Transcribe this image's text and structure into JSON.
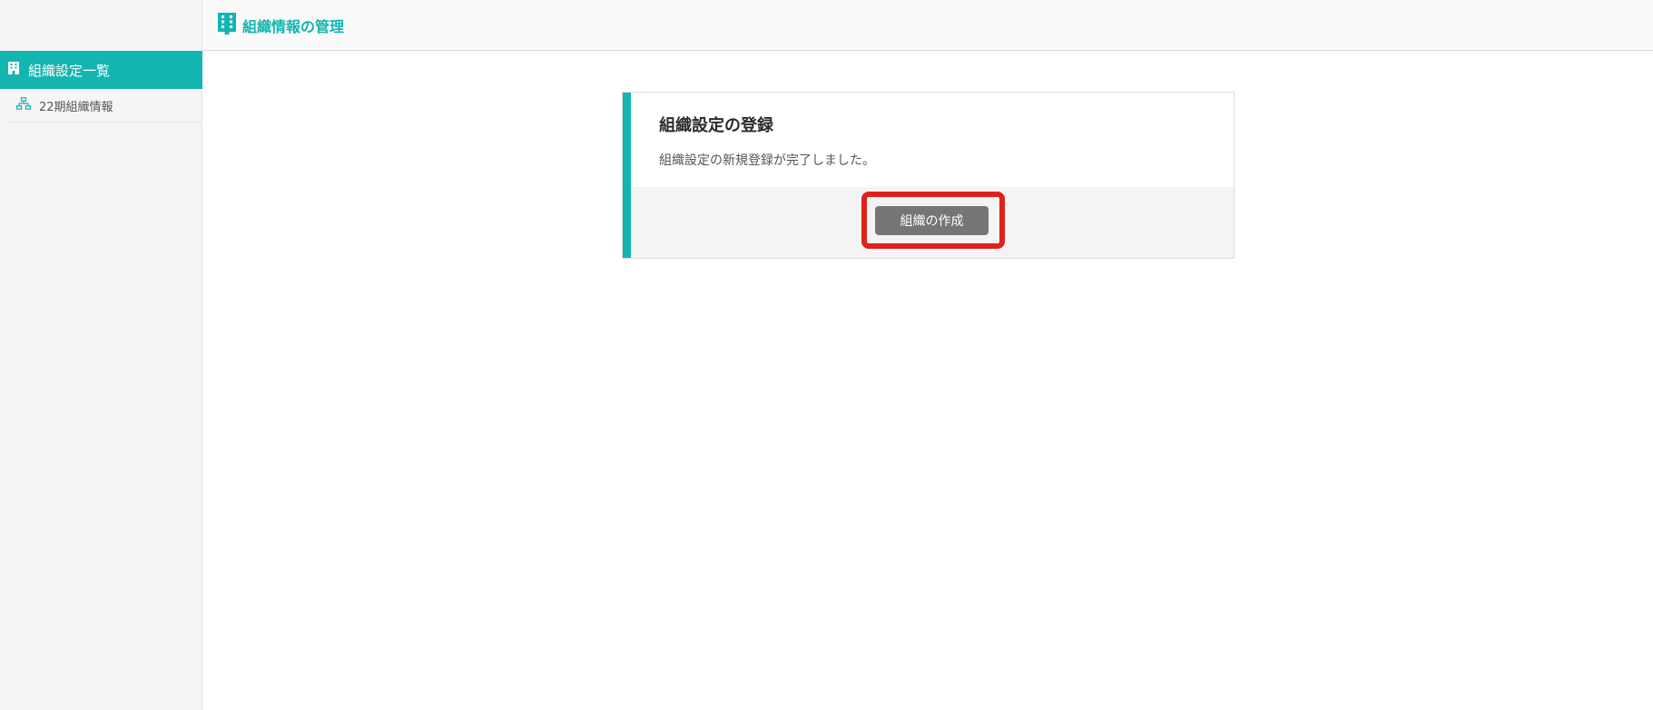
{
  "header": {
    "title": "組織情報の管理",
    "icon": "building-icon"
  },
  "sidebar": {
    "active_item": {
      "label": "組織設定一覧",
      "icon": "building-icon"
    },
    "items": [
      {
        "label": "22期組織情報",
        "icon": "org-chart-icon"
      }
    ]
  },
  "card": {
    "title": "組織設定の登録",
    "message": "組織設定の新規登録が完了しました。",
    "button_label": "組織の作成"
  },
  "colors": {
    "accent": "#13b5b1",
    "button": "#757575",
    "highlight": "#e0201b"
  }
}
